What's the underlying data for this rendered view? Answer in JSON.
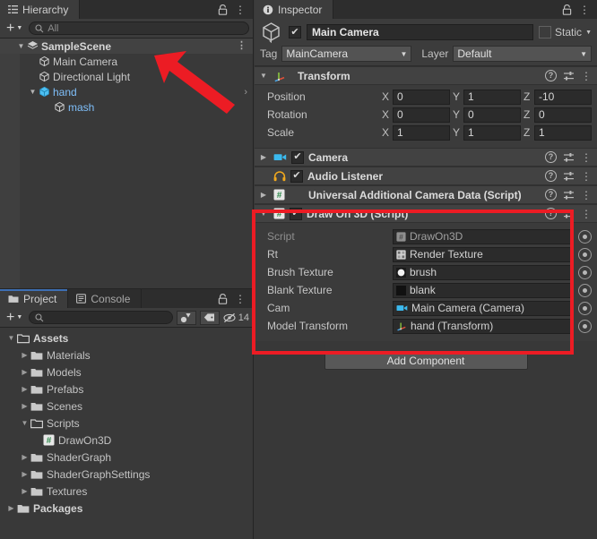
{
  "hierarchy": {
    "tab_label": "Hierarchy",
    "tab_icon": "hierarchy-icon",
    "lock_icon": "lock-icon",
    "menu_icon": "kebab-menu-icon",
    "add_label": "+",
    "search_placeholder": "All",
    "search_value": "",
    "items": [
      {
        "label": "SampleScene",
        "icon": "scene-icon",
        "depth": 0,
        "expanded": true,
        "type": "scene"
      },
      {
        "label": "Main Camera",
        "icon": "gameobject-cube-icon",
        "depth": 1,
        "expanded": null,
        "type": "gameobject"
      },
      {
        "label": "Directional Light",
        "icon": "gameobject-cube-icon",
        "depth": 1,
        "expanded": null,
        "type": "gameobject"
      },
      {
        "label": "hand",
        "icon": "prefab-cube-icon",
        "depth": 1,
        "expanded": true,
        "type": "prefab"
      },
      {
        "label": "mash",
        "icon": "gameobject-cube-icon",
        "depth": 2,
        "expanded": null,
        "type": "prefab-child"
      }
    ]
  },
  "project": {
    "tabs": [
      {
        "label": "Project",
        "icon": "folder-icon",
        "active": true
      },
      {
        "label": "Console",
        "icon": "console-icon",
        "active": false
      }
    ],
    "lock_icon": "lock-icon",
    "menu_icon": "kebab-menu-icon",
    "add_label": "+",
    "search_placeholder": "",
    "search_value": "",
    "filter_type_icon": "filter-by-type-icon",
    "filter_label_icon": "filter-by-label-icon",
    "hidden_icon": "eye-slash-icon",
    "hidden_count": "14",
    "items": [
      {
        "label": "Assets",
        "icon": "folder-open-icon",
        "depth": 0,
        "expanded": true,
        "bold": true
      },
      {
        "label": "Materials",
        "icon": "folder-icon",
        "depth": 1,
        "expanded": false,
        "bold": false
      },
      {
        "label": "Models",
        "icon": "folder-icon",
        "depth": 1,
        "expanded": false,
        "bold": false
      },
      {
        "label": "Prefabs",
        "icon": "folder-icon",
        "depth": 1,
        "expanded": false,
        "bold": false
      },
      {
        "label": "Scenes",
        "icon": "folder-icon",
        "depth": 1,
        "expanded": false,
        "bold": false
      },
      {
        "label": "Scripts",
        "icon": "folder-open-icon",
        "depth": 1,
        "expanded": true,
        "bold": false
      },
      {
        "label": "DrawOn3D",
        "icon": "csharp-script-icon",
        "depth": 2,
        "expanded": null,
        "bold": false
      },
      {
        "label": "ShaderGraph",
        "icon": "folder-icon",
        "depth": 1,
        "expanded": false,
        "bold": false
      },
      {
        "label": "ShaderGraphSettings",
        "icon": "folder-icon",
        "depth": 1,
        "expanded": false,
        "bold": false
      },
      {
        "label": "Textures",
        "icon": "folder-icon",
        "depth": 1,
        "expanded": false,
        "bold": false
      },
      {
        "label": "Packages",
        "icon": "folder-icon",
        "depth": 0,
        "expanded": false,
        "bold": true
      }
    ]
  },
  "inspector": {
    "tab_label": "Inspector",
    "tab_icon": "info-icon",
    "lock_icon": "lock-icon",
    "menu_icon": "kebab-menu-icon",
    "object_name": "Main Camera",
    "object_enabled": true,
    "static_label": "Static",
    "static_checked": false,
    "tag_label": "Tag",
    "tag_value": "MainCamera",
    "layer_label": "Layer",
    "layer_value": "Default",
    "transform": {
      "title": "Transform",
      "icon": "transform-axis-icon",
      "expanded": true,
      "rows": [
        {
          "label": "Position",
          "x": "0",
          "y": "1",
          "z": "-10"
        },
        {
          "label": "Rotation",
          "x": "0",
          "y": "0",
          "z": "0"
        },
        {
          "label": "Scale",
          "x": "1",
          "y": "1",
          "z": "1"
        }
      ],
      "axis_labels": [
        "X",
        "Y",
        "Z"
      ]
    },
    "components": [
      {
        "title": "Camera",
        "icon": "camera-icon",
        "expanded": false,
        "has_toggle": true,
        "checked": true,
        "has_arrow": true
      },
      {
        "title": "Audio Listener",
        "icon": "headphones-icon",
        "expanded": false,
        "has_toggle": true,
        "checked": true,
        "has_arrow": false
      },
      {
        "title": "Universal Additional Camera Data (Script)",
        "icon": "csharp-script-icon",
        "expanded": false,
        "has_toggle": false,
        "checked": false,
        "has_arrow": true
      }
    ],
    "draw_on_3d": {
      "title": "Draw On 3D (Script)",
      "icon": "csharp-script-icon",
      "expanded": true,
      "checked": true,
      "highlighted": true,
      "properties": [
        {
          "label": "Script",
          "value": "DrawOn3D",
          "icon": "csharp-script-icon",
          "readonly": true
        },
        {
          "label": "Rt",
          "value": "Render Texture",
          "icon": "render-texture-icon",
          "readonly": false
        },
        {
          "label": "Brush Texture",
          "value": "brush",
          "icon": "texture-white-circle-icon",
          "readonly": false
        },
        {
          "label": "Blank Texture",
          "value": "blank",
          "icon": "texture-black-square-icon",
          "readonly": false
        },
        {
          "label": "Cam",
          "value": "Main Camera (Camera)",
          "icon": "camera-icon",
          "readonly": false
        },
        {
          "label": "Model Transform",
          "value": "hand (Transform)",
          "icon": "transform-axis-icon",
          "readonly": false
        }
      ]
    },
    "add_component_label": "Add Component"
  },
  "annotations": {
    "arrow": {
      "name": "red-arrow-pointing-to-main-camera",
      "color": "#ec1c24"
    },
    "box": {
      "name": "red-highlight-box-draw-on-3d",
      "color": "#ec1c24"
    }
  }
}
